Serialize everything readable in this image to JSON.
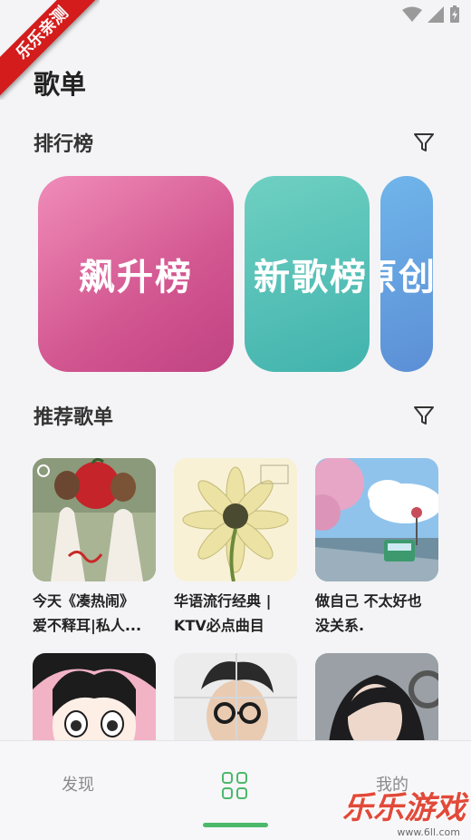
{
  "ribbon": {
    "text": "乐乐亲测"
  },
  "page_title": "歌单",
  "ranking": {
    "title": "排行榜",
    "cards": [
      {
        "label": "飙升榜"
      },
      {
        "label": "新歌榜"
      },
      {
        "label": "原创"
      }
    ]
  },
  "recommend": {
    "title": "推荐歌单",
    "playlists": [
      {
        "line1": "今天《凑热闹》",
        "line2": "爱不释耳|私人..."
      },
      {
        "line1": "华语流行经典 |",
        "line2": "KTV必点曲目"
      },
      {
        "line1": "做自己 不太好也",
        "line2": "没关系."
      },
      {
        "line1": "",
        "line2": ""
      },
      {
        "line1": "",
        "line2": ""
      },
      {
        "line1": "",
        "line2": ""
      }
    ]
  },
  "tabbar": {
    "discover": "发现",
    "mine": "我的"
  },
  "watermark": {
    "text": "乐乐游戏",
    "url": "www.6ll.com"
  },
  "colors": {
    "accent": "#4cb86a",
    "rank1": "#d25690",
    "rank2": "#41b3ad",
    "rank3": "#5c8fd6"
  }
}
